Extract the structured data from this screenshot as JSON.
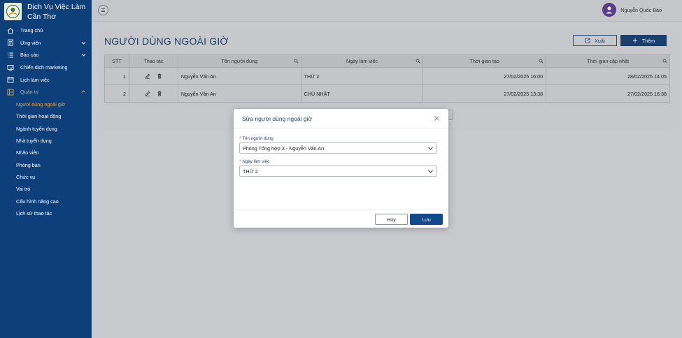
{
  "app": {
    "brand_line1": "Dịch Vụ Việc Làm",
    "brand_line2": "Cần Thơ",
    "user_name": "Nguyễn Quốc Bảo"
  },
  "sidebar": {
    "items": [
      {
        "label": "Trang chủ",
        "icon": "home-icon"
      },
      {
        "label": "Ứng viên",
        "icon": "document-icon",
        "has_chevron": true
      },
      {
        "label": "Báo cáo",
        "icon": "list-icon",
        "has_chevron": true
      },
      {
        "label": "Chiến dịch marketing",
        "icon": "campaign-icon"
      },
      {
        "label": "Lịch làm việc",
        "icon": "calendar-icon"
      },
      {
        "label": "Quản trị",
        "icon": "admin-icon",
        "has_chevron": true,
        "expanded": true
      }
    ],
    "sub_items": [
      {
        "label": "Người dùng ngoài giờ",
        "active": true
      },
      {
        "label": "Thời gian hoạt động"
      },
      {
        "label": "Ngành tuyển dụng"
      },
      {
        "label": "Nhà tuyển dụng"
      },
      {
        "label": "Nhân viên"
      },
      {
        "label": "Phòng ban"
      },
      {
        "label": "Chức vụ"
      },
      {
        "label": "Vai trò"
      },
      {
        "label": "Cấu hình nâng cao"
      },
      {
        "label": "Lịch sử thao tác"
      }
    ]
  },
  "page": {
    "title": "NGƯỜI DÙNG NGOÀI GIỜ",
    "export_label": "Xuất",
    "add_label": "Thêm"
  },
  "table": {
    "headers": [
      "STT",
      "Thao tác",
      "Tên người dùng",
      "Ngày làm việc",
      "Thời gian tạo",
      "Thời gian cập nhật"
    ],
    "rows": [
      {
        "stt": "1",
        "name": "Nguyễn Văn An",
        "day": "THỨ 2",
        "created": "27/02/2025 16:00",
        "updated": "28/02/2025 14:05"
      },
      {
        "stt": "2",
        "name": "Nguyễn Văn An",
        "day": "CHỦ NHẬT",
        "created": "27/02/2025 13:38",
        "updated": "27/02/2025 16:38"
      }
    ]
  },
  "modal": {
    "title": "Sửa người dùng ngoài giờ",
    "user_label": "Tên người dùng",
    "user_value": "Phòng Tổng hợp 3 - Nguyễn Văn An",
    "day_label": "Ngày làm việc",
    "day_value": "THỨ 2",
    "cancel_label": "Hủy",
    "save_label": "Lưu"
  },
  "colors": {
    "sidebar_bg": "#0d3f7a",
    "accent_orange": "#f0a640",
    "primary": "#11498a"
  }
}
